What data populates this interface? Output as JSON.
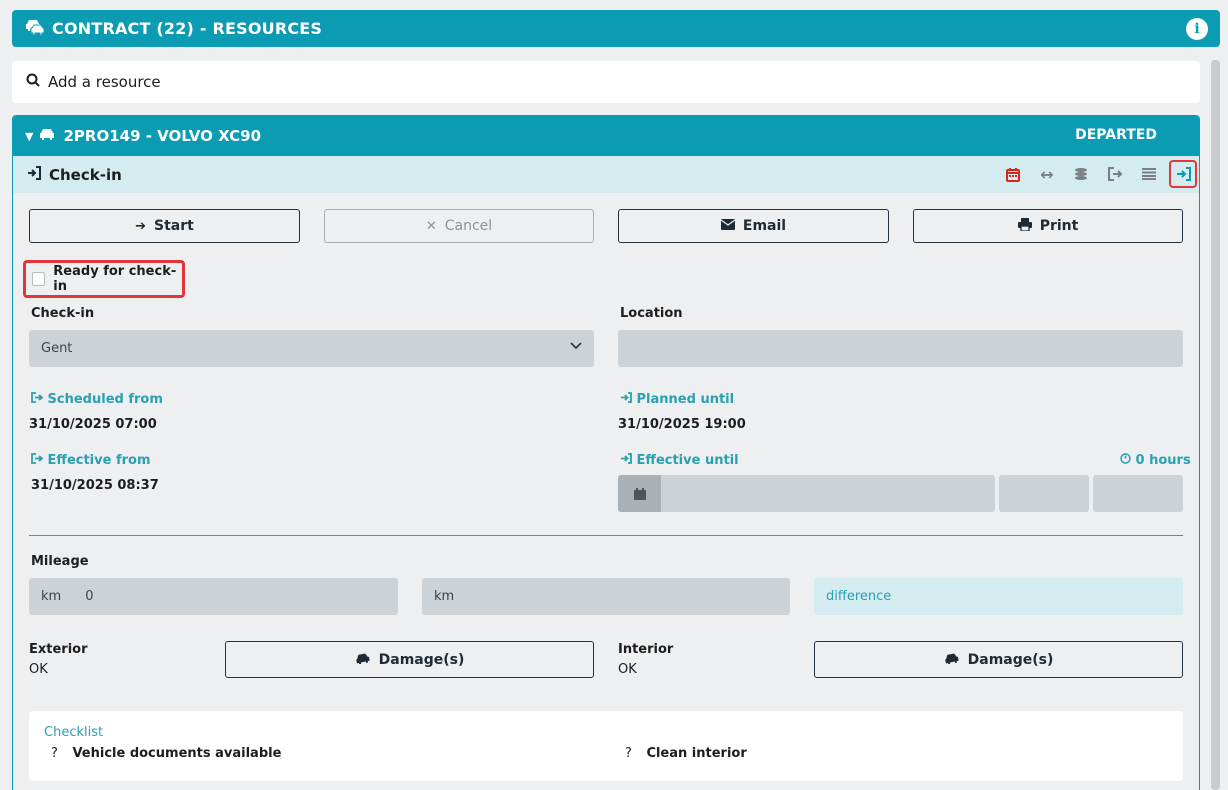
{
  "header": {
    "title": "CONTRACT (22) - RESOURCES",
    "info_icon": "info-icon"
  },
  "search": {
    "label": "Add a resource"
  },
  "resource": {
    "name": "2PRO149 - VOLVO XC90",
    "status": "DEPARTED",
    "section": "Check-in",
    "toolbar": [
      "calendar-icon",
      "arrows-horizontal-icon",
      "coins-icon",
      "sign-out-icon",
      "list-icon",
      "sign-in-icon"
    ],
    "accent": "#0b9bb3"
  },
  "actions": {
    "start": "Start",
    "cancel": "Cancel",
    "email": "Email",
    "print": "Print"
  },
  "ready": {
    "label": "Ready for check-in",
    "checked": false
  },
  "checkin": {
    "label": "Check-in",
    "value": "Gent"
  },
  "location": {
    "label": "Location",
    "value": ""
  },
  "scheduled_from": {
    "label": "Scheduled from",
    "value": "31/10/2025 07:00"
  },
  "planned_until": {
    "label": "Planned until",
    "value": "31/10/2025 19:00"
  },
  "effective_from": {
    "label": "Effective from",
    "value": "31/10/2025 08:37"
  },
  "effective_until": {
    "label": "Effective until",
    "duration": "0 hours"
  },
  "mileage": {
    "label": "Mileage",
    "start_unit": "km",
    "start_value": "0",
    "end_unit": "km",
    "difference": "difference"
  },
  "exterior": {
    "label": "Exterior",
    "value": "OK",
    "button": "Damage(s)"
  },
  "interior": {
    "label": "Interior",
    "value": "OK",
    "button": "Damage(s)"
  },
  "checklist": {
    "title": "Checklist",
    "items": [
      "Vehicle documents available",
      "Clean interior"
    ]
  }
}
